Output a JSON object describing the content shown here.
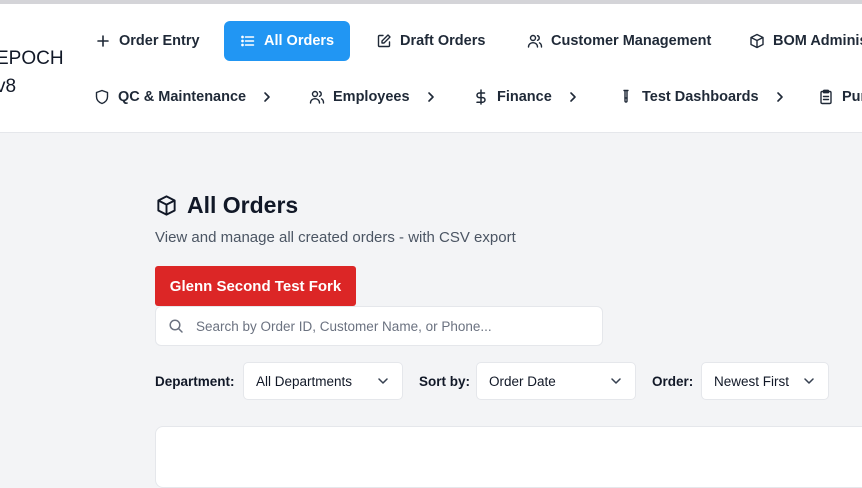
{
  "brand": {
    "line1": "EPOCH",
    "line2": "v8"
  },
  "nav_row1": [
    {
      "label": "Order Entry",
      "icon": "plus-icon"
    },
    {
      "label": "All Orders",
      "icon": "list-icon",
      "active": true
    },
    {
      "label": "Draft Orders",
      "icon": "edit-icon"
    },
    {
      "label": "Customer Management",
      "icon": "users-icon"
    },
    {
      "label": "BOM Administ",
      "icon": "box-icon"
    }
  ],
  "nav_row2": [
    {
      "label": "QC & Maintenance",
      "icon": "shield-icon"
    },
    {
      "label": "Employees",
      "icon": "users-icon"
    },
    {
      "label": "Finance",
      "icon": "dollar-icon"
    },
    {
      "label": "Test Dashboards",
      "icon": "test-tube-icon"
    },
    {
      "label": "Pur",
      "icon": "clipboard-icon"
    }
  ],
  "page": {
    "title": "All Orders",
    "subtitle": "View and manage all created orders - with CSV export",
    "action_button": "Glenn Second Test Fork"
  },
  "search": {
    "placeholder": "Search by Order ID, Customer Name, or Phone...",
    "value": ""
  },
  "filters": {
    "department_label": "Department:",
    "department_value": "All Departments",
    "sort_label": "Sort by:",
    "sort_value": "Order Date",
    "order_label": "Order:",
    "order_value": "Newest First"
  },
  "colors": {
    "accent": "#2196f3",
    "danger": "#dc2626",
    "background": "#f3f4f6"
  }
}
